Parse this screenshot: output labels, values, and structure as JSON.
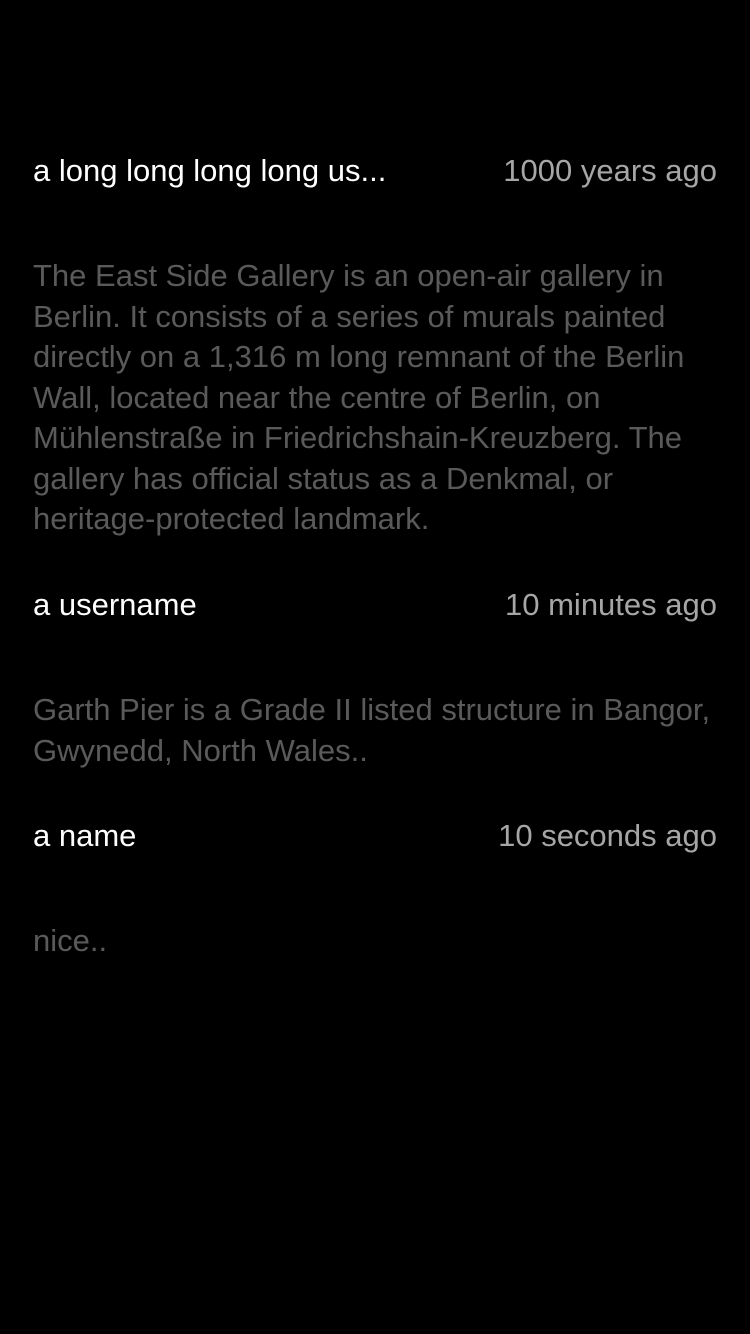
{
  "comments": [
    {
      "username": "a long long long long us...",
      "time": "1000 years ago",
      "text": "The East Side Gallery is an open-air gallery in Berlin. It consists of a series of murals painted directly on a 1,316 m long remnant of the Berlin Wall, located near the centre of Berlin, on Mühlenstraße in Friedrichshain-Kreuzberg. The gallery has official status as a Denkmal, or heritage-protected landmark."
    },
    {
      "username": "a username",
      "time": "10 minutes ago",
      "text": "Garth Pier is a Grade II listed structure in Bangor, Gwynedd, North Wales.."
    },
    {
      "username": "a name",
      "time": "10 seconds ago",
      "text": "nice.."
    }
  ],
  "colors": {
    "background": "#000000",
    "username": "#ffffff",
    "timestamp": "#a6a6a6",
    "body_text": "#5a5a5a"
  }
}
